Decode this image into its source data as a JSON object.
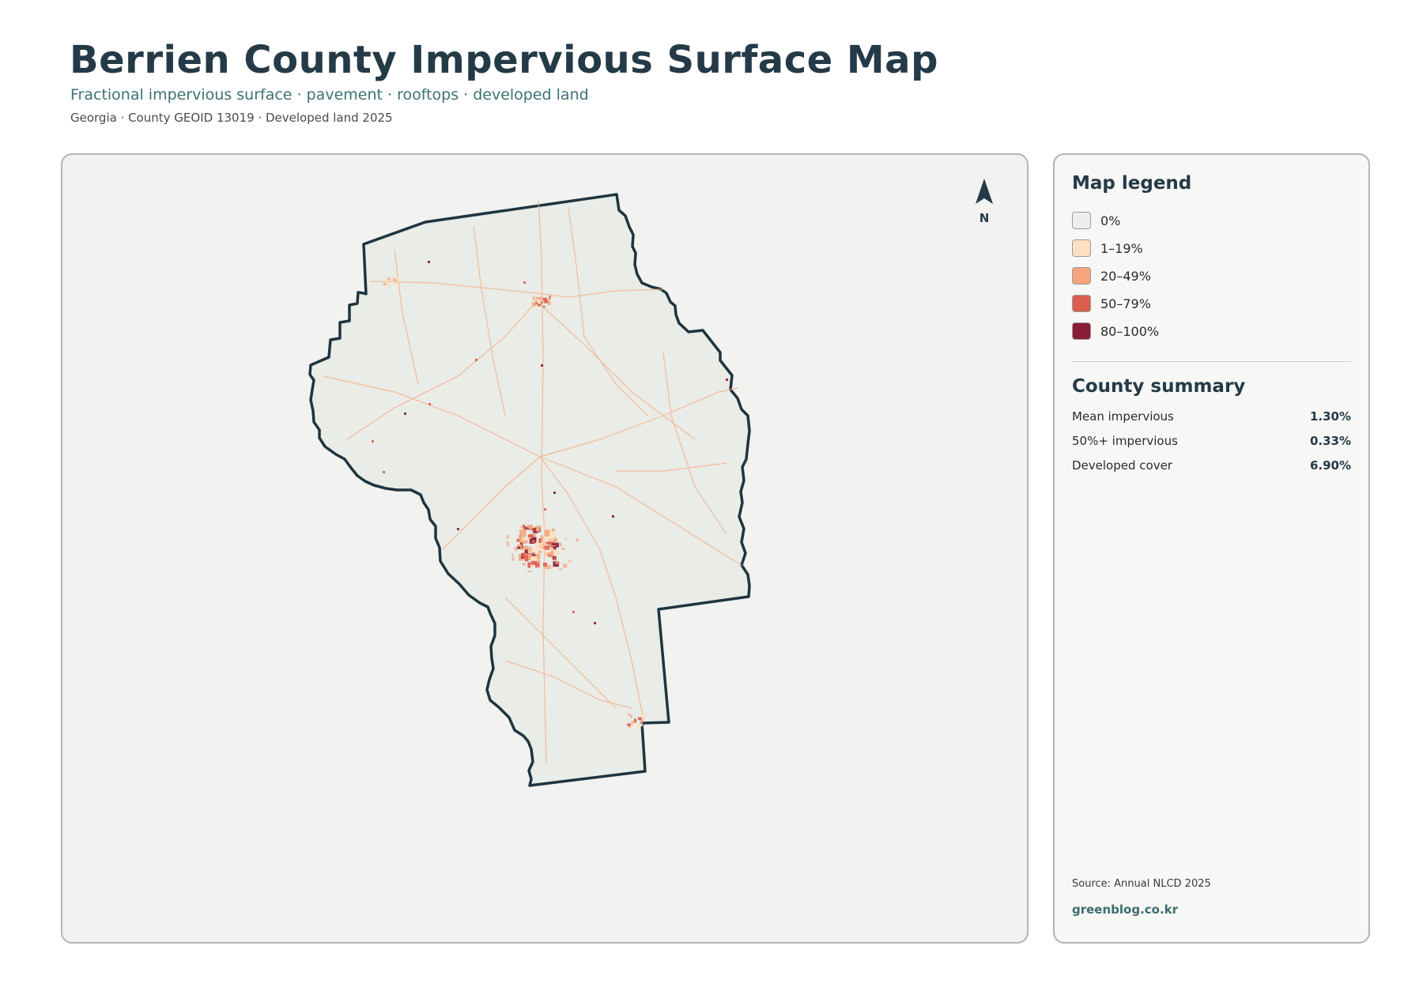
{
  "header": {
    "title": "Berrien County Impervious Surface Map",
    "subtitle": "Fractional impervious surface · pavement · rooftops · developed land",
    "meta": "Georgia · County GEOID 13019 · Developed land 2025"
  },
  "map": {
    "north_label": "N",
    "boundary_color": "#1f3540",
    "fill_color": "#e9ece7"
  },
  "legend": {
    "heading": "Map legend",
    "items": [
      {
        "label": "0%",
        "color": "#eeeeec"
      },
      {
        "label": "1–19%",
        "color": "#fde0c0"
      },
      {
        "label": "20–49%",
        "color": "#f4a57e"
      },
      {
        "label": "50–79%",
        "color": "#db5f4e"
      },
      {
        "label": "80–100%",
        "color": "#8b1c36"
      }
    ]
  },
  "summary": {
    "heading": "County summary",
    "rows": [
      {
        "label": "Mean impervious",
        "value": "1.30%"
      },
      {
        "label": "50%+ impervious",
        "value": "0.33%"
      },
      {
        "label": "Developed cover",
        "value": "6.90%"
      }
    ]
  },
  "footer": {
    "source": "Source: Annual NLCD 2025",
    "brand": "greenblog.co.kr"
  }
}
